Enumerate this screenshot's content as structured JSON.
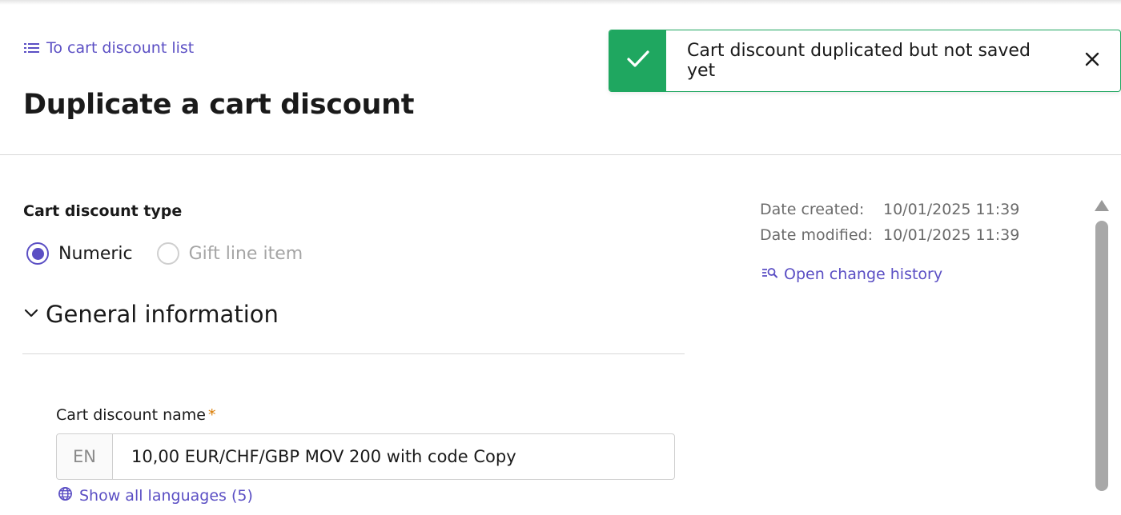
{
  "header": {
    "back_link_label": "To cart discount list",
    "page_title": "Duplicate a cart discount"
  },
  "toast": {
    "message": "Cart discount duplicated but not saved yet",
    "accent_color": "#1fa760",
    "icon": "check-icon"
  },
  "discount_type": {
    "label": "Cart discount type",
    "options": [
      {
        "label": "Numeric",
        "selected": true,
        "disabled": false
      },
      {
        "label": "Gift line item",
        "selected": false,
        "disabled": true
      }
    ]
  },
  "general_information": {
    "section_title": "General information",
    "name_field": {
      "label": "Cart discount name",
      "required_marker": "*",
      "language": "EN",
      "value": "10,00 EUR/CHF/GBP MOV 200 with code Copy"
    },
    "show_all_languages_label": "Show all languages (5)"
  },
  "metadata": {
    "date_created_label": "Date created:",
    "date_created_value": "10/01/2025 11:39",
    "date_modified_label": "Date modified:",
    "date_modified_value": "10/01/2025 11:39",
    "history_link_label": "Open change history"
  },
  "colors": {
    "primary": "#5b4fc4",
    "success": "#1fa760",
    "required": "#d97a00"
  }
}
